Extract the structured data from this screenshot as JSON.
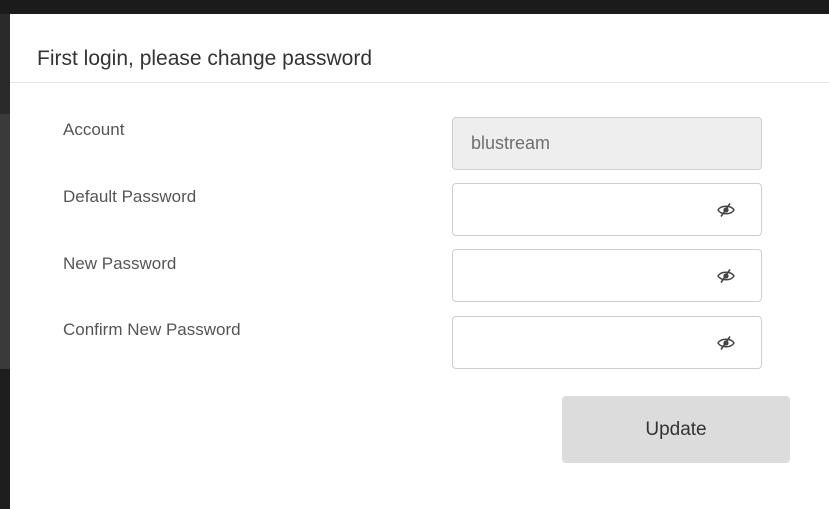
{
  "dialog": {
    "title": "First login, please change password"
  },
  "form": {
    "account": {
      "label": "Account",
      "value": "blustream"
    },
    "default_password": {
      "label": "Default Password",
      "value": "",
      "icon": "eye-slash-icon"
    },
    "new_password": {
      "label": "New Password",
      "value": "",
      "icon": "eye-slash-icon"
    },
    "confirm_password": {
      "label": "Confirm New Password",
      "value": "",
      "icon": "eye-slash-icon"
    }
  },
  "actions": {
    "update_label": "Update"
  },
  "colors": {
    "readonly_field_bg": "#eeeeee",
    "button_bg": "#dcdcdc",
    "backdrop": "#1b1b1b"
  }
}
